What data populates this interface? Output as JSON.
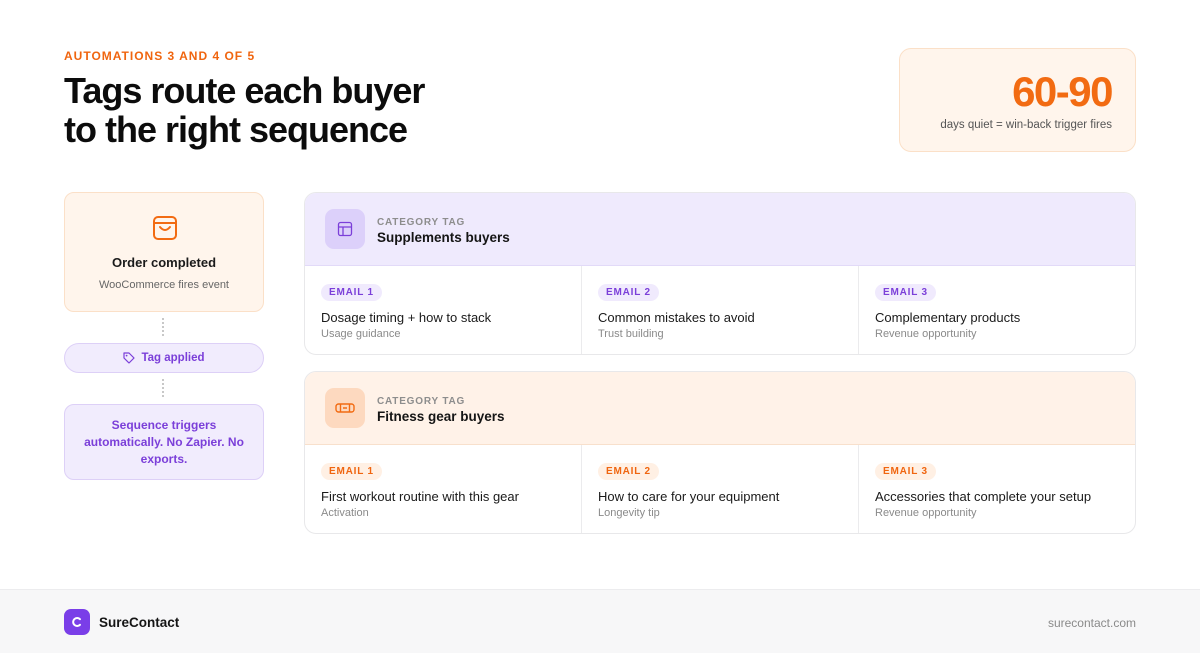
{
  "header": {
    "eyebrow": "AUTOMATIONS 3 AND 4 OF 5",
    "title_line1": "Tags route each buyer",
    "title_line2": "to the right sequence"
  },
  "stat": {
    "value": "60-90",
    "caption": "days quiet = win-back trigger fires"
  },
  "flow": {
    "order_title": "Order completed",
    "order_subtitle": "WooCommerce fires event",
    "tag_label": "Tag applied",
    "sequence_text": "Sequence triggers automatically. No Zapier. No exports."
  },
  "categories": [
    {
      "label": "CATEGORY TAG",
      "name": "Supplements buyers",
      "icon": "layout-icon",
      "emails": [
        {
          "badge": "EMAIL 1",
          "title": "Dosage timing + how to stack",
          "subtitle": "Usage guidance"
        },
        {
          "badge": "EMAIL 2",
          "title": "Common mistakes to avoid",
          "subtitle": "Trust building"
        },
        {
          "badge": "EMAIL 3",
          "title": "Complementary products",
          "subtitle": "Revenue opportunity"
        }
      ]
    },
    {
      "label": "CATEGORY TAG",
      "name": "Fitness gear buyers",
      "icon": "dumbbell-icon",
      "emails": [
        {
          "badge": "EMAIL 1",
          "title": "First workout routine with this gear",
          "subtitle": "Activation"
        },
        {
          "badge": "EMAIL 2",
          "title": "How to care for your equipment",
          "subtitle": "Longevity tip"
        },
        {
          "badge": "EMAIL 3",
          "title": "Accessories that complete your setup",
          "subtitle": "Revenue opportunity"
        }
      ]
    }
  ],
  "footer": {
    "brand": "SureContact",
    "site": "surecontact.com"
  },
  "colors": {
    "accent_orange": "#f26b12",
    "accent_purple": "#7b3fd9",
    "brand_purple": "#7a3ee8"
  }
}
